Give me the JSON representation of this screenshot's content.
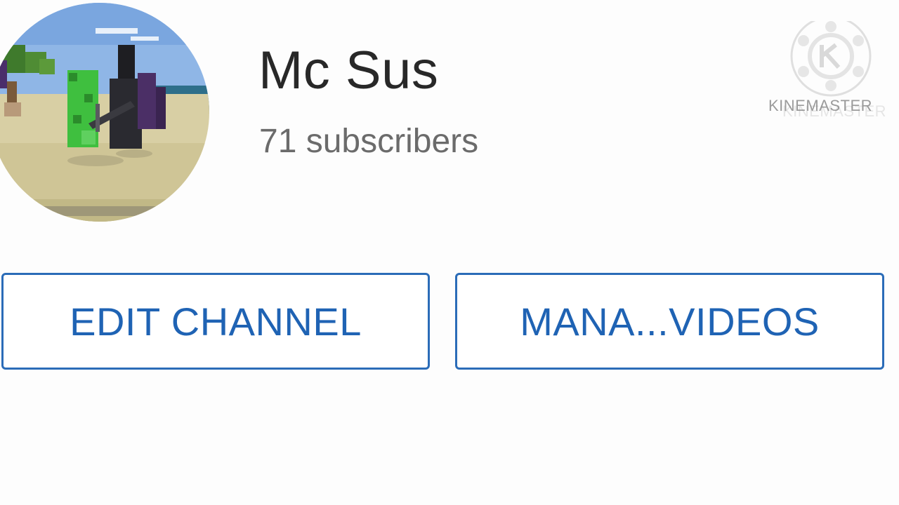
{
  "channel": {
    "name": "Mc Sus",
    "subscribers": "71 subscribers"
  },
  "buttons": {
    "edit_channel": "EDIT CHANNEL",
    "manage_videos": "MANA...VIDEOS"
  },
  "watermark": {
    "text": "KINEMASTER"
  },
  "colors": {
    "accent": "#2b6cb8",
    "button_text": "#1f63b4",
    "title_text": "#282828",
    "subtext": "#6b6b6b"
  }
}
